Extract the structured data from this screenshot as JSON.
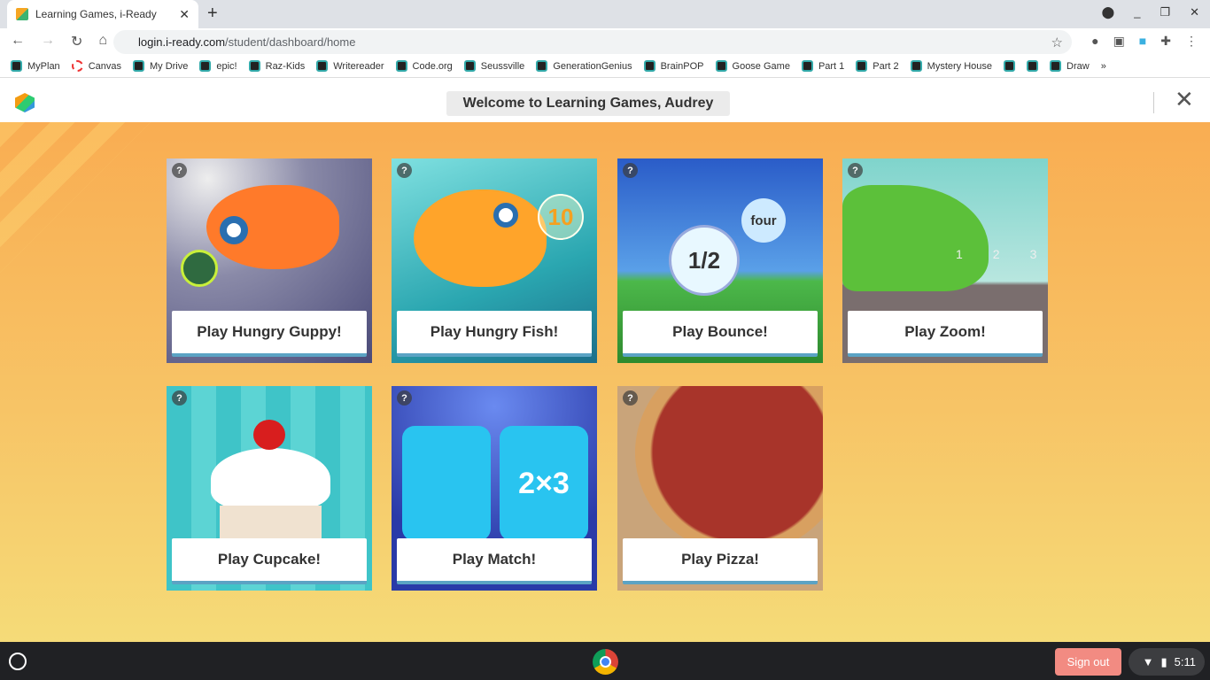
{
  "browser": {
    "tab_title": "Learning Games, i-Ready",
    "url_host": "login.i-ready.com",
    "url_path": "/student/dashboard/home"
  },
  "bookmarks": [
    "MyPlan",
    "Canvas",
    "My Drive",
    "epic!",
    "Raz-Kids",
    "Writereader",
    "Code.org",
    "Seussville",
    "GenerationGenius",
    "BrainPOP",
    "Goose Game",
    "Part 1",
    "Part 2",
    "Mystery House",
    "",
    "",
    "Draw"
  ],
  "header": {
    "welcome": "Welcome to Learning Games, Audrey"
  },
  "games": [
    {
      "label": "Play Hungry Guppy!"
    },
    {
      "label": "Play Hungry Fish!"
    },
    {
      "label": "Play Bounce!"
    },
    {
      "label": "Play Zoom!"
    },
    {
      "label": "Play Cupcake!"
    },
    {
      "label": "Play Match!"
    },
    {
      "label": "Play Pizza!"
    }
  ],
  "art_text": {
    "fish_number": "10",
    "bounce_fraction": "1/2",
    "bounce_word": "four",
    "match_expr": "2×3",
    "zoom_ticks": [
      "1",
      "2",
      "3"
    ]
  },
  "help_label": "?",
  "taskbar": {
    "sign_out": "Sign out",
    "time": "5:11"
  }
}
